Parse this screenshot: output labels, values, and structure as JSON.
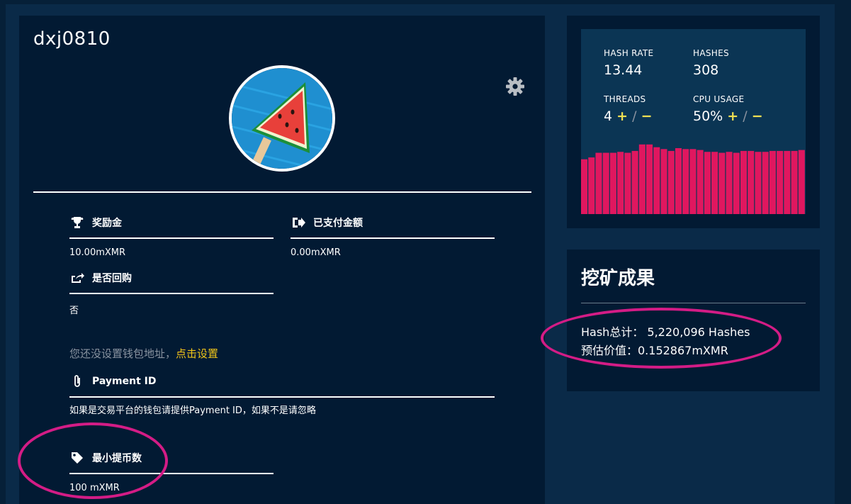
{
  "profile": {
    "username": "dxj0810"
  },
  "fields": {
    "reward": {
      "label": "奖励金",
      "value": "10.00mXMR"
    },
    "paid": {
      "label": "已支付金额",
      "value": "0.00mXMR"
    },
    "buyback": {
      "label": "是否回购",
      "value": "否"
    },
    "payment_id": {
      "label": "Payment ID"
    },
    "min_withdraw": {
      "label": "最小提币数",
      "value": "100 mXMR"
    }
  },
  "wallet": {
    "note": "您还没设置钱包地址，",
    "link": "点击设置"
  },
  "payment_note": "如果是交易平台的钱包请提供Payment ID，如果不是请忽略",
  "stats": {
    "hash_rate_label": "HASH RATE",
    "hash_rate": "13.44",
    "hashes_label": "HASHES",
    "hashes": "308",
    "threads_label": "THREADS",
    "threads": "4",
    "cpu_label": "CPU USAGE",
    "cpu": "50%",
    "plus": "+",
    "slash": "/",
    "minus": "−",
    "bar_color": "#e0175f",
    "bar_levels": [
      0.59,
      0.61,
      0.66,
      0.66,
      0.66,
      0.67,
      0.66,
      0.68,
      0.75,
      0.75,
      0.72,
      0.7,
      0.68,
      0.71,
      0.7,
      0.7,
      0.69,
      0.67,
      0.67,
      0.66,
      0.67,
      0.66,
      0.68,
      0.68,
      0.67,
      0.67,
      0.68,
      0.68,
      0.68,
      0.68,
      0.69
    ]
  },
  "result": {
    "title": "挖矿成果",
    "hash_total": "Hash总计： 5,220,096 Hashes",
    "est_value": "预估价值：0.152867mXMR"
  },
  "colors": {
    "highlight": "#d41c86",
    "link": "#f0c419"
  }
}
